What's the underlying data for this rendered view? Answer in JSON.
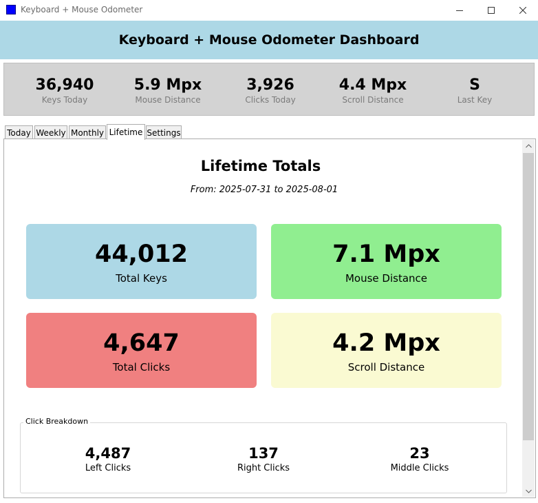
{
  "window": {
    "title": "Keyboard + Mouse Odometer",
    "icon": "app-icon",
    "controls": [
      "minimize-icon",
      "maximize-icon",
      "close-icon"
    ]
  },
  "header": {
    "title": "Keyboard + Mouse Odometer Dashboard"
  },
  "stats": [
    {
      "value": "36,940",
      "label": "Keys Today"
    },
    {
      "value": "5.9 Mpx",
      "label": "Mouse Distance"
    },
    {
      "value": "3,926",
      "label": "Clicks Today"
    },
    {
      "value": "4.4 Mpx",
      "label": "Scroll Distance"
    },
    {
      "value": "S",
      "label": "Last Key"
    }
  ],
  "tabs": [
    {
      "label": "Today"
    },
    {
      "label": "Weekly"
    },
    {
      "label": "Monthly"
    },
    {
      "label": "Lifetime"
    },
    {
      "label": "Settings"
    }
  ],
  "active_tab": "Lifetime",
  "lifetime": {
    "title": "Lifetime Totals",
    "range": "From: 2025-07-31 to 2025-08-01",
    "cards": [
      {
        "value": "44,012",
        "label": "Total Keys",
        "color": "#add8e6"
      },
      {
        "value": "7.1 Mpx",
        "label": "Mouse Distance",
        "color": "#90ee90"
      },
      {
        "value": "4,647",
        "label": "Total Clicks",
        "color": "#f08080"
      },
      {
        "value": "4.2 Mpx",
        "label": "Scroll Distance",
        "color": "#fafad2"
      }
    ],
    "click_breakdown": {
      "title": "Click Breakdown",
      "items": [
        {
          "value": "4,487",
          "label": "Left Clicks"
        },
        {
          "value": "137",
          "label": "Right Clicks"
        },
        {
          "value": "23",
          "label": "Middle Clicks"
        }
      ]
    }
  },
  "colors": {
    "header_bg": "#add8e6",
    "stats_bg": "#d3d3d3",
    "app_icon": "#0000ff"
  }
}
